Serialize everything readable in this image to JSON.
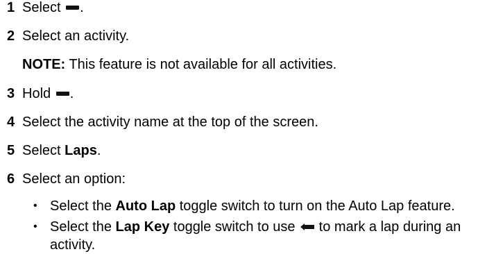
{
  "steps": [
    {
      "num": "1",
      "pre": "Select ",
      "icon": "menu-button-icon",
      "post": "."
    },
    {
      "num": "2",
      "text": "Select an activity."
    },
    {
      "num": "3",
      "pre": "Hold ",
      "icon": "menu-button-icon",
      "post": "."
    },
    {
      "num": "4",
      "text": "Select the activity name at the top of the screen."
    },
    {
      "num": "5",
      "pre": "Select ",
      "bold": "Laps",
      "post": "."
    },
    {
      "num": "6",
      "text": "Select an option:"
    }
  ],
  "note": {
    "label": "NOTE:",
    "text": " This feature is not available for all activities."
  },
  "options": [
    {
      "bullet": "•",
      "pre": "Select the ",
      "bold": "Auto Lap",
      "post": " toggle switch to turn on the Auto Lap feature."
    },
    {
      "bullet": "•",
      "pre": "Select the ",
      "bold": "Lap Key",
      "mid": " toggle switch to use ",
      "icon": "back-button-icon",
      "post": " to mark a lap during an activity."
    }
  ]
}
